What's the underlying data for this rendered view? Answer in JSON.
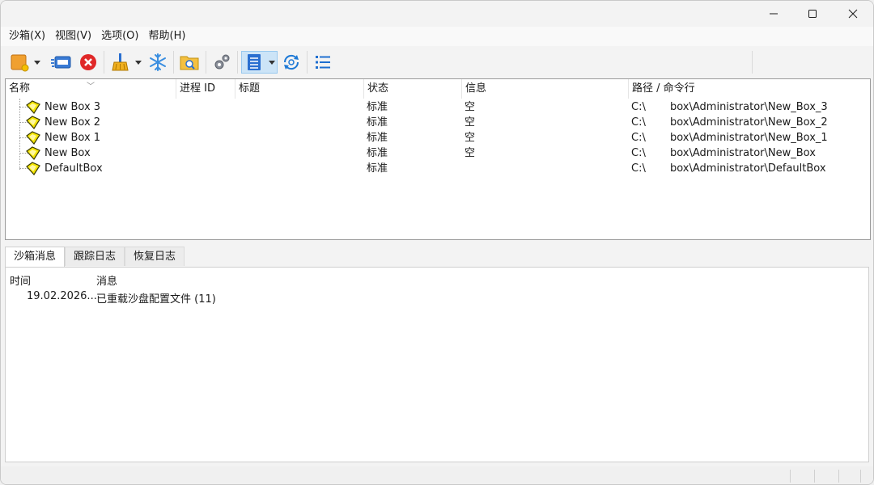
{
  "window": {
    "controls": {
      "minimize": "minimize-icon",
      "maximize": "maximize-icon",
      "close": "close-icon"
    }
  },
  "menu": [
    "沙箱(X)",
    "视图(V)",
    "选项(O)",
    "帮助(H)"
  ],
  "toolbar": {
    "icons": [
      "new-sandbox-icon",
      "run-program-icon",
      "terminate-all-icon",
      "delete-contents-icon",
      "freeze-icon",
      "explore-contents-icon",
      "sandbox-settings-icon",
      "view-options-icon",
      "refresh-icon",
      "list-view-icon"
    ]
  },
  "list": {
    "columns": [
      "名称",
      "进程 ID",
      "标题",
      "状态",
      "信息",
      "路径 / 命令行"
    ],
    "rows": [
      {
        "name": "New Box 3",
        "status": "标准",
        "info": "空",
        "drive": "C:\\",
        "path": "box\\Administrator\\New_Box_3"
      },
      {
        "name": "New Box 2",
        "status": "标准",
        "info": "空",
        "drive": "C:\\",
        "path": "box\\Administrator\\New_Box_2"
      },
      {
        "name": "New Box 1",
        "status": "标准",
        "info": "空",
        "drive": "C:\\",
        "path": "box\\Administrator\\New_Box_1"
      },
      {
        "name": "New Box",
        "status": "标准",
        "info": "空",
        "drive": "C:\\",
        "path": "box\\Administrator\\New_Box"
      },
      {
        "name": "DefaultBox",
        "status": "标准",
        "info": "",
        "drive": "C:\\",
        "path": "box\\Administrator\\DefaultBox"
      }
    ],
    "colors": {
      "box_fill": "#f5e600",
      "box_stroke": "#3a3a00"
    }
  },
  "tabs": [
    "沙箱消息",
    "跟踪日志",
    "恢复日志"
  ],
  "log": {
    "columns": [
      "时间",
      "消息"
    ],
    "entries": [
      {
        "time": "19.02.2026...",
        "message": "已重载沙盘配置文件 (11)"
      }
    ]
  }
}
